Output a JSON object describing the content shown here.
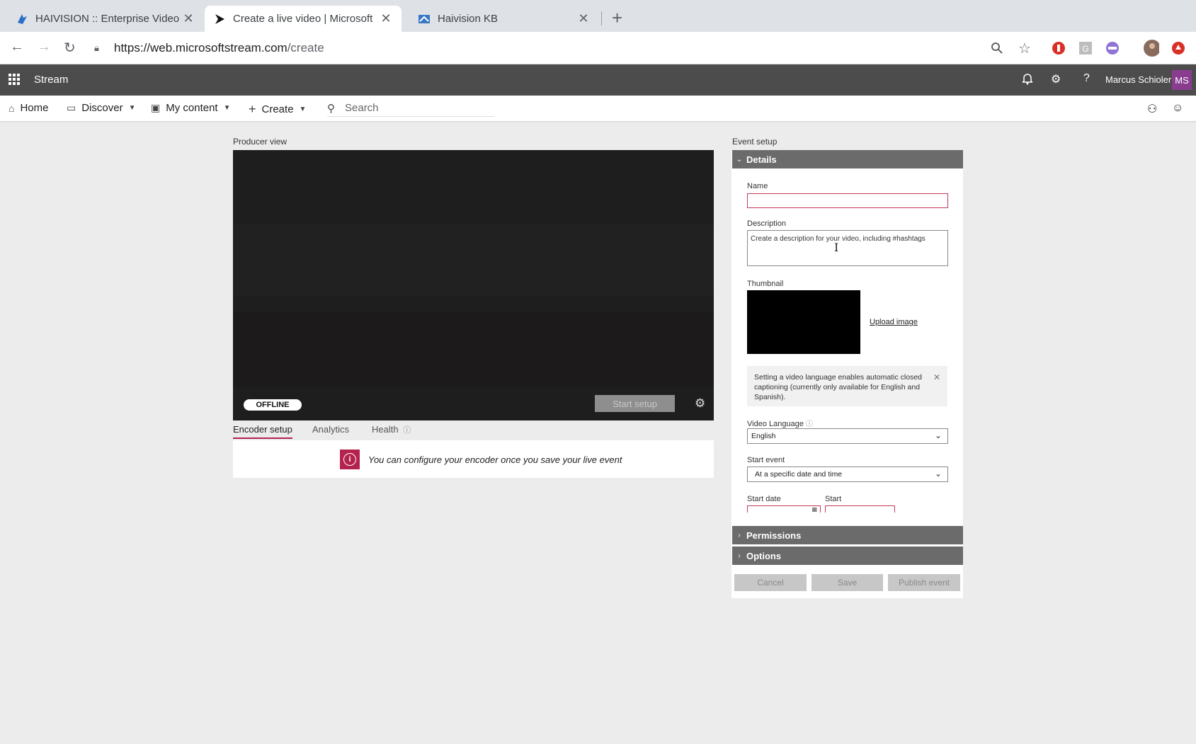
{
  "browser": {
    "tabs": [
      {
        "title": "HAIVISION :: Enterprise Video",
        "icon": "haivision-favicon",
        "active": false
      },
      {
        "title": "Create a live video | Microsoft",
        "icon": "stream-favicon",
        "active": true
      },
      {
        "title": "Haivision KB",
        "icon": "haivision-kb-favicon",
        "active": false
      }
    ],
    "url_domain": "https://web.microsoftstream.com",
    "url_path": "/create"
  },
  "app": {
    "name": "Stream",
    "user_name": "Marcus Schioler",
    "user_initials": "MS",
    "accent": "#b4234e",
    "header_bg": "#4c4c4c"
  },
  "nav": {
    "home": "Home",
    "discover": "Discover",
    "my_content": "My content",
    "create": "Create",
    "search_placeholder": "Search"
  },
  "producer": {
    "label": "Producer view",
    "status_badge": "OFFLINE",
    "start_setup": "Start setup",
    "tabs": [
      "Encoder setup",
      "Analytics",
      "Health"
    ],
    "encoder_message": "You can configure your encoder once you save your live event"
  },
  "event_setup": {
    "label": "Event setup",
    "details": {
      "title": "Details",
      "name_label": "Name",
      "name_value": "",
      "description_label": "Description",
      "description_placeholder": "Create a description for your video, including #hashtags",
      "thumbnail_label": "Thumbnail",
      "upload_image": "Upload image",
      "notice": "Setting a video language enables automatic closed captioning (currently only available for English and Spanish).",
      "video_language_label": "Video Language",
      "video_language_value": "English",
      "start_event_label": "Start event",
      "start_event_value": "At a specific date and time",
      "start_date_label": "Start date",
      "start_time_label": "Start"
    },
    "permissions_title": "Permissions",
    "options_title": "Options",
    "buttons": {
      "cancel": "Cancel",
      "save": "Save",
      "publish": "Publish event"
    }
  }
}
